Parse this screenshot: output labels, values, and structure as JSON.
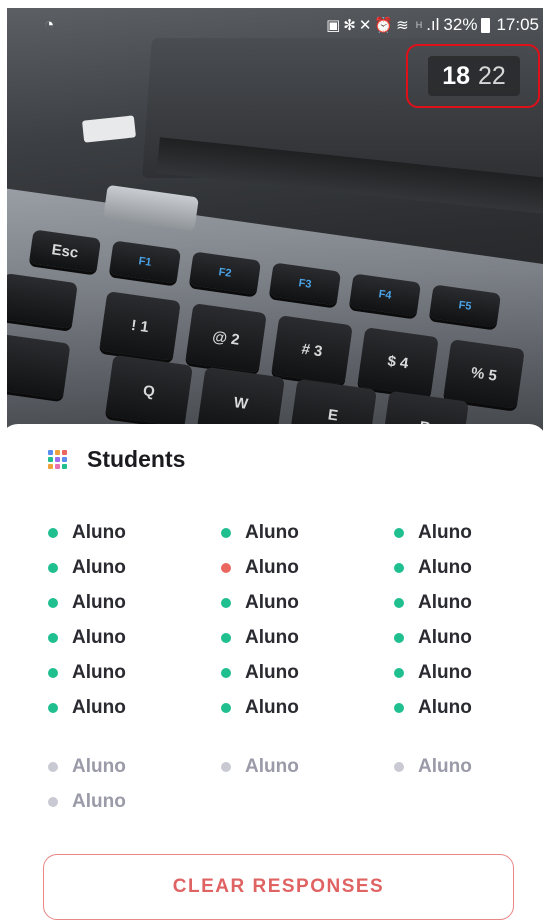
{
  "status_bar": {
    "signal_text": "H",
    "battery": "32%",
    "time": "17:05",
    "icons": [
      "camera-notification-icon",
      "bluetooth-icon",
      "mute-icon",
      "alarm-icon",
      "wifi-icon",
      "signal-icon",
      "battery-icon"
    ]
  },
  "counter": {
    "answered": "18",
    "total": "22",
    "highlight_color": "#e0101a"
  },
  "sheet": {
    "title": "Students",
    "title_icon": "grid-icon",
    "colors": {
      "answered": "#1fbf8f",
      "incorrect": "#e9675f",
      "pending": "#c9c9d3"
    },
    "students": [
      {
        "name": "Aluno",
        "state": "answered"
      },
      {
        "name": "Aluno",
        "state": "answered"
      },
      {
        "name": "Aluno",
        "state": "answered"
      },
      {
        "name": "Aluno",
        "state": "answered"
      },
      {
        "name": "Aluno",
        "state": "incorrect"
      },
      {
        "name": "Aluno",
        "state": "answered"
      },
      {
        "name": "Aluno",
        "state": "answered"
      },
      {
        "name": "Aluno",
        "state": "answered"
      },
      {
        "name": "Aluno",
        "state": "answered"
      },
      {
        "name": "Aluno",
        "state": "answered"
      },
      {
        "name": "Aluno",
        "state": "answered"
      },
      {
        "name": "Aluno",
        "state": "answered"
      },
      {
        "name": "Aluno",
        "state": "answered"
      },
      {
        "name": "Aluno",
        "state": "answered"
      },
      {
        "name": "Aluno",
        "state": "answered"
      },
      {
        "name": "Aluno",
        "state": "answered"
      },
      {
        "name": "Aluno",
        "state": "answered"
      },
      {
        "name": "Aluno",
        "state": "answered"
      },
      {
        "name": "Aluno",
        "state": "pending"
      },
      {
        "name": "Aluno",
        "state": "pending"
      },
      {
        "name": "Aluno",
        "state": "pending"
      },
      {
        "name": "Aluno",
        "state": "pending"
      }
    ],
    "clear_button": "CLEAR RESPONSES"
  },
  "camera_keys": {
    "fn": [
      "Esc",
      "F1",
      "F2",
      "F3",
      "F4",
      "F5"
    ],
    "num": [
      "!",
      "@",
      "#",
      "$",
      "%"
    ],
    "num_digits": [
      "1",
      "2",
      "3",
      "4",
      "5"
    ],
    "letters": [
      "Q",
      "W",
      "E",
      "R"
    ]
  }
}
